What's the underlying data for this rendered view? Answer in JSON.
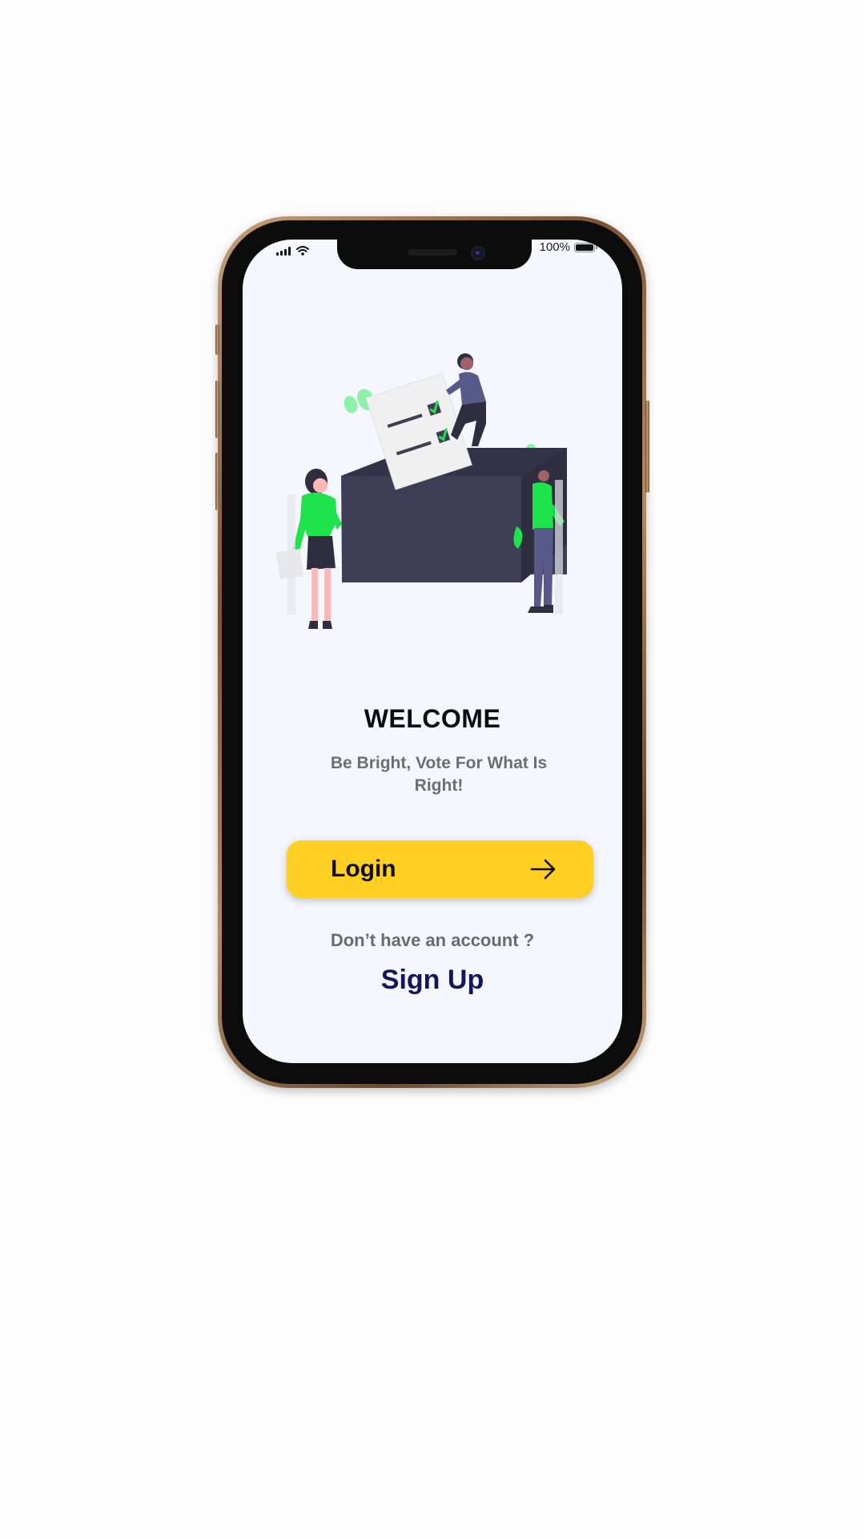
{
  "status_bar": {
    "battery_percent": "100%",
    "icons": [
      "cellular-signal-icon",
      "wifi-icon",
      "battery-icon"
    ]
  },
  "welcome": {
    "title": "WELCOME",
    "subtitle": "Be Bright, Vote For What Is Right!"
  },
  "login_button": {
    "label": "Login",
    "icon": "arrow-right-icon"
  },
  "signup_section": {
    "prompt": "Don’t have an account ?",
    "link_label": "Sign Up"
  },
  "colors": {
    "screen_background": "#f5f6fe",
    "login_button": "#ffcf24",
    "signup_link": "#14165a",
    "illustration_accent": "#1fe34c",
    "ballot_box": "#3f3d56"
  }
}
